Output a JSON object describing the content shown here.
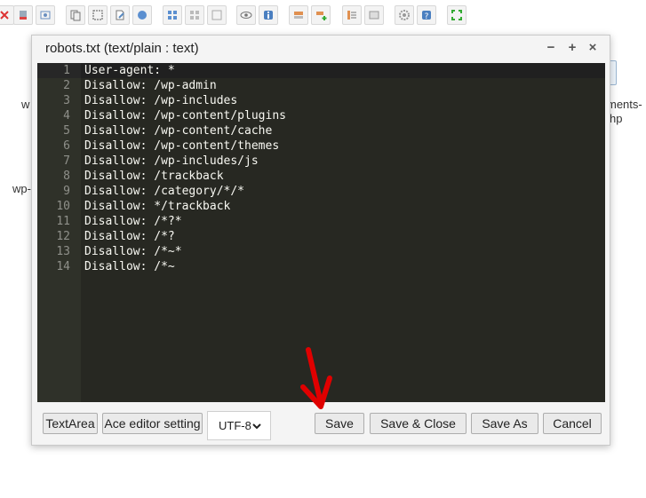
{
  "toolbar": {
    "icons": [
      "delete-icon",
      "clipboard-icon",
      "image-icon",
      "copy-icon",
      "select-icon",
      "file-edit-icon",
      "network-icon",
      "grid-icon",
      "grid-alt-icon",
      "view-icon",
      "info-icon",
      "move-icon",
      "add-icon",
      "list-icon",
      "properties-icon",
      "settings-icon",
      "help-icon",
      "fullscreen-icon"
    ]
  },
  "background": {
    "label_w": "w",
    "label_ments": "ments-",
    "label_php": "hp",
    "label_wp": "wp-"
  },
  "dialog": {
    "title": "robots.txt (text/plain : text)",
    "minimize": "−",
    "maximize": "+",
    "close": "×"
  },
  "editor": {
    "lines": [
      {
        "n": "1",
        "text": "User-agent: *"
      },
      {
        "n": "2",
        "text": "Disallow: /wp-admin"
      },
      {
        "n": "3",
        "text": "Disallow: /wp-includes"
      },
      {
        "n": "4",
        "text": "Disallow: /wp-content/plugins"
      },
      {
        "n": "5",
        "text": "Disallow: /wp-content/cache"
      },
      {
        "n": "6",
        "text": "Disallow: /wp-content/themes"
      },
      {
        "n": "7",
        "text": "Disallow: /wp-includes/js"
      },
      {
        "n": "8",
        "text": "Disallow: /trackback"
      },
      {
        "n": "9",
        "text": "Disallow: /category/*/*"
      },
      {
        "n": "10",
        "text": "Disallow: */trackback"
      },
      {
        "n": "11",
        "text": "Disallow: /*?*"
      },
      {
        "n": "12",
        "text": "Disallow: /*?"
      },
      {
        "n": "13",
        "text": "Disallow: /*~*"
      },
      {
        "n": "14",
        "text": "Disallow: /*~"
      }
    ]
  },
  "footer": {
    "textarea": "TextArea",
    "ace_settings": "Ace editor setting",
    "encoding": "UTF-8",
    "save": "Save",
    "save_close": "Save & Close",
    "save_as": "Save As",
    "cancel": "Cancel"
  },
  "colors": {
    "editor_bg": "#272822",
    "annotation_arrow": "#e00000"
  }
}
